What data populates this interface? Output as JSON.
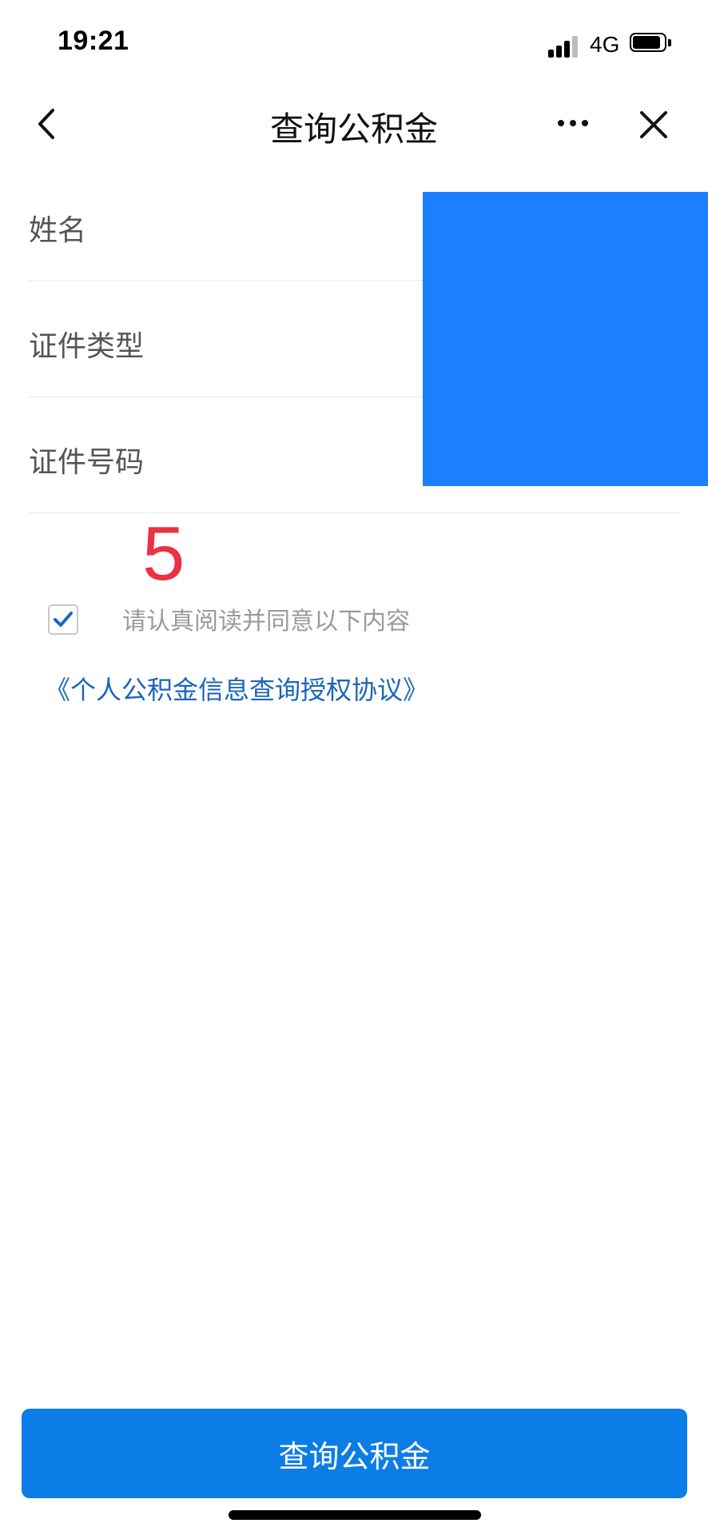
{
  "status_bar": {
    "time": "19:21",
    "network": "4G",
    "icons": [
      "signal-icon",
      "battery-icon"
    ]
  },
  "nav": {
    "title": "查询公积金",
    "icons": [
      "back-icon",
      "more-icon",
      "close-icon"
    ]
  },
  "form": {
    "fields": [
      {
        "label": "姓名"
      },
      {
        "label": "证件类型"
      },
      {
        "label": "证件号码"
      }
    ]
  },
  "annotation": {
    "number": "5"
  },
  "agreement": {
    "checked": true,
    "prompt": "请认真阅读并同意以下内容",
    "link": "《个人公积金信息查询授权协议》"
  },
  "submit": {
    "label": "查询公积金"
  },
  "colors": {
    "accent": "#0c7de6",
    "link": "#1a66b8",
    "redaction": "#1c7fff",
    "annotation": "#ea3244"
  }
}
